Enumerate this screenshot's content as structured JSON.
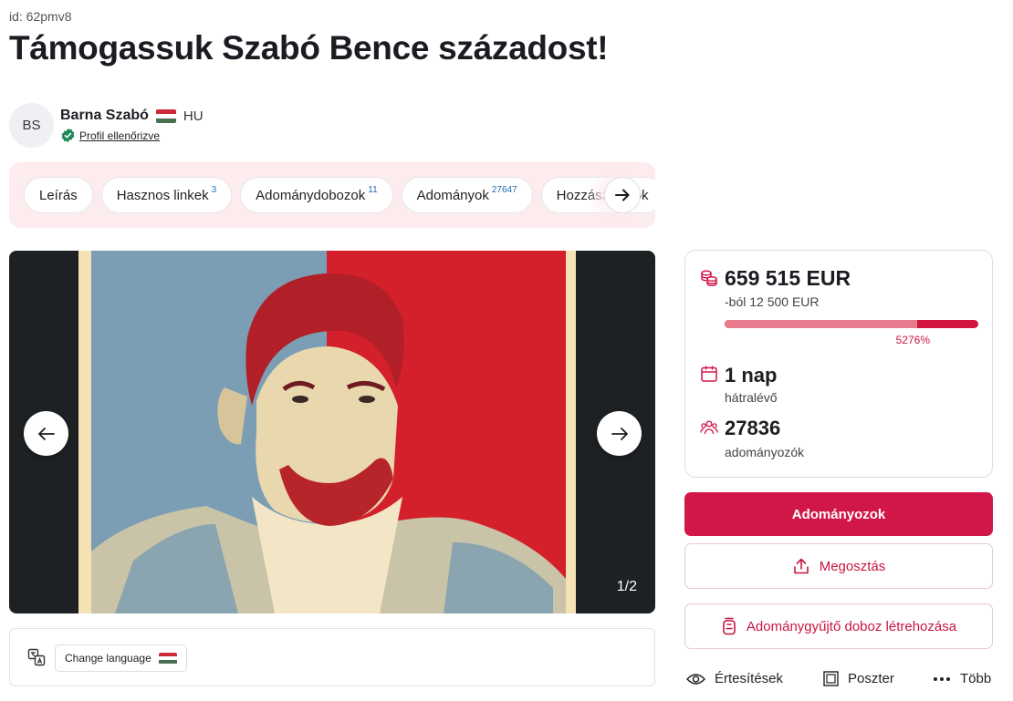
{
  "campaign": {
    "id_label": "id: 62pmv8",
    "title": "Támogassuk Szabó Bence századost!"
  },
  "organizer": {
    "initials": "BS",
    "name": "Barna Szabó",
    "country": "HU",
    "verified_label": "Profil ellenőrizve"
  },
  "tabs": [
    {
      "label": "Leírás",
      "count": ""
    },
    {
      "label": "Hasznos linkek",
      "count": "3"
    },
    {
      "label": "Adománydobozok",
      "count": "11"
    },
    {
      "label": "Adományok",
      "count": "27647"
    },
    {
      "label": "Hozzászólások",
      "count": ""
    }
  ],
  "gallery": {
    "counter": "1/2"
  },
  "language": {
    "button_label": "Change language"
  },
  "stats": {
    "raised": "659 515 EUR",
    "goal": "-ból 12 500 EUR",
    "progress_fraction": 0.76,
    "percent_label": "5276%",
    "days": "1 nap",
    "days_label": "hátralévő",
    "donors": "27836",
    "donors_label": "adományozók"
  },
  "actions": {
    "donate": "Adományozok",
    "share": "Megosztás",
    "create_box": "Adománygyűjtő doboz létrehozása",
    "notifications": "Értesítések",
    "poster": "Poszter",
    "more": "Több"
  },
  "colors": {
    "accent": "#d11648",
    "tabs_background": "#fdecee",
    "progress_light": "#e87b8e",
    "verified": "#1e8a5a"
  }
}
